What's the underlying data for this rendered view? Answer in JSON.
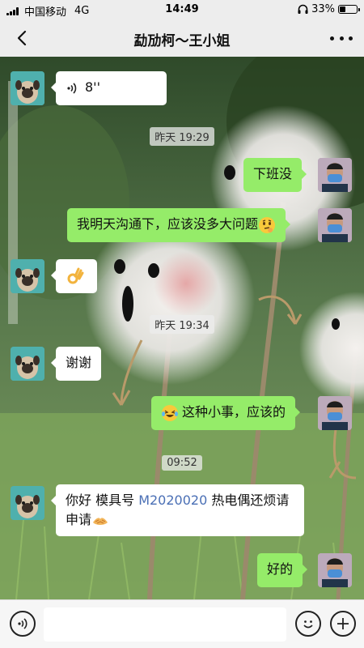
{
  "status_bar": {
    "carrier": "中国移动",
    "network": "4G",
    "time": "14:49",
    "battery": "33%",
    "battery_level": 0.33
  },
  "nav": {
    "title": "勐劢柯～王小姐",
    "back_icon": "chevron-left-icon",
    "more_icon": "more-icon"
  },
  "messages": [
    {
      "side": "in",
      "type": "voice",
      "text": "8''"
    },
    {
      "type": "timestamp",
      "text": "昨天 19:29"
    },
    {
      "side": "me",
      "text": "下班没"
    },
    {
      "side": "me",
      "text": "我明天沟通下，应该没多大问题",
      "emoji": "thinking-face-emoji"
    },
    {
      "side": "in",
      "emoji": "ok-hand-emoji"
    },
    {
      "type": "timestamp",
      "text": "昨天 19:34"
    },
    {
      "side": "in",
      "text": "谢谢"
    },
    {
      "side": "me",
      "text": "这种小事，应该的",
      "emoji": "tears-of-joy-emoji"
    },
    {
      "type": "timestamp",
      "text": "09:52"
    },
    {
      "side": "in",
      "text_before": "你好 模具号 ",
      "link": "M2020020",
      "text_after": " 热电偶还烦请申请",
      "emoji": "folded-hands-emoji"
    },
    {
      "side": "me",
      "text": "好的"
    }
  ],
  "colors": {
    "bubble_me": "#95ec69",
    "bubble_in": "#ffffff",
    "link": "#4a6fb5",
    "bar_bg": "#ededed"
  },
  "input_bar": {
    "voice_icon": "voice-toggle-icon",
    "emoji_icon": "emoji-icon",
    "plus_icon": "plus-icon"
  }
}
